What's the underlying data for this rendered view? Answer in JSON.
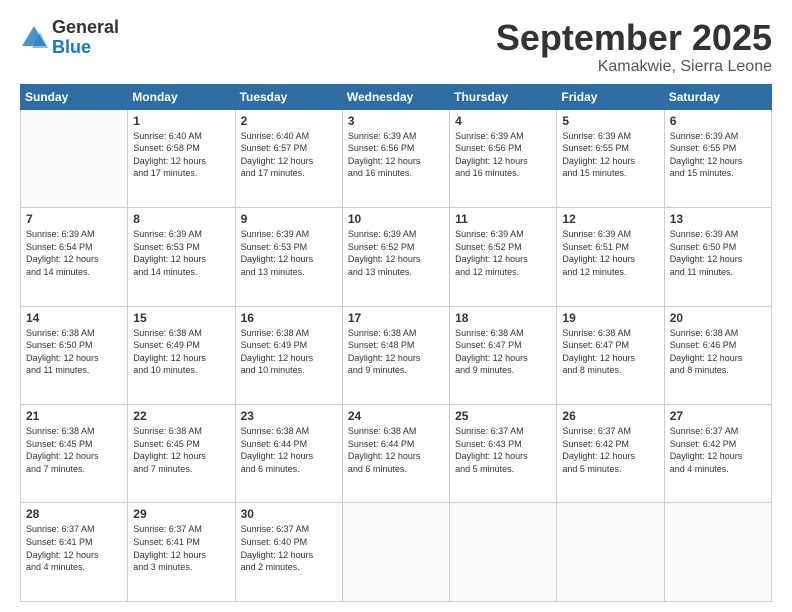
{
  "logo": {
    "general": "General",
    "blue": "Blue"
  },
  "header": {
    "month": "September 2025",
    "location": "Kamakwie, Sierra Leone"
  },
  "weekdays": [
    "Sunday",
    "Monday",
    "Tuesday",
    "Wednesday",
    "Thursday",
    "Friday",
    "Saturday"
  ],
  "weeks": [
    [
      {
        "day": "",
        "info": ""
      },
      {
        "day": "1",
        "info": "Sunrise: 6:40 AM\nSunset: 6:58 PM\nDaylight: 12 hours\nand 17 minutes."
      },
      {
        "day": "2",
        "info": "Sunrise: 6:40 AM\nSunset: 6:57 PM\nDaylight: 12 hours\nand 17 minutes."
      },
      {
        "day": "3",
        "info": "Sunrise: 6:39 AM\nSunset: 6:56 PM\nDaylight: 12 hours\nand 16 minutes."
      },
      {
        "day": "4",
        "info": "Sunrise: 6:39 AM\nSunset: 6:56 PM\nDaylight: 12 hours\nand 16 minutes."
      },
      {
        "day": "5",
        "info": "Sunrise: 6:39 AM\nSunset: 6:55 PM\nDaylight: 12 hours\nand 15 minutes."
      },
      {
        "day": "6",
        "info": "Sunrise: 6:39 AM\nSunset: 6:55 PM\nDaylight: 12 hours\nand 15 minutes."
      }
    ],
    [
      {
        "day": "7",
        "info": "Sunrise: 6:39 AM\nSunset: 6:54 PM\nDaylight: 12 hours\nand 14 minutes."
      },
      {
        "day": "8",
        "info": "Sunrise: 6:39 AM\nSunset: 6:53 PM\nDaylight: 12 hours\nand 14 minutes."
      },
      {
        "day": "9",
        "info": "Sunrise: 6:39 AM\nSunset: 6:53 PM\nDaylight: 12 hours\nand 13 minutes."
      },
      {
        "day": "10",
        "info": "Sunrise: 6:39 AM\nSunset: 6:52 PM\nDaylight: 12 hours\nand 13 minutes."
      },
      {
        "day": "11",
        "info": "Sunrise: 6:39 AM\nSunset: 6:52 PM\nDaylight: 12 hours\nand 12 minutes."
      },
      {
        "day": "12",
        "info": "Sunrise: 6:39 AM\nSunset: 6:51 PM\nDaylight: 12 hours\nand 12 minutes."
      },
      {
        "day": "13",
        "info": "Sunrise: 6:39 AM\nSunset: 6:50 PM\nDaylight: 12 hours\nand 11 minutes."
      }
    ],
    [
      {
        "day": "14",
        "info": "Sunrise: 6:38 AM\nSunset: 6:50 PM\nDaylight: 12 hours\nand 11 minutes."
      },
      {
        "day": "15",
        "info": "Sunrise: 6:38 AM\nSunset: 6:49 PM\nDaylight: 12 hours\nand 10 minutes."
      },
      {
        "day": "16",
        "info": "Sunrise: 6:38 AM\nSunset: 6:49 PM\nDaylight: 12 hours\nand 10 minutes."
      },
      {
        "day": "17",
        "info": "Sunrise: 6:38 AM\nSunset: 6:48 PM\nDaylight: 12 hours\nand 9 minutes."
      },
      {
        "day": "18",
        "info": "Sunrise: 6:38 AM\nSunset: 6:47 PM\nDaylight: 12 hours\nand 9 minutes."
      },
      {
        "day": "19",
        "info": "Sunrise: 6:38 AM\nSunset: 6:47 PM\nDaylight: 12 hours\nand 8 minutes."
      },
      {
        "day": "20",
        "info": "Sunrise: 6:38 AM\nSunset: 6:46 PM\nDaylight: 12 hours\nand 8 minutes."
      }
    ],
    [
      {
        "day": "21",
        "info": "Sunrise: 6:38 AM\nSunset: 6:45 PM\nDaylight: 12 hours\nand 7 minutes."
      },
      {
        "day": "22",
        "info": "Sunrise: 6:38 AM\nSunset: 6:45 PM\nDaylight: 12 hours\nand 7 minutes."
      },
      {
        "day": "23",
        "info": "Sunrise: 6:38 AM\nSunset: 6:44 PM\nDaylight: 12 hours\nand 6 minutes."
      },
      {
        "day": "24",
        "info": "Sunrise: 6:38 AM\nSunset: 6:44 PM\nDaylight: 12 hours\nand 6 minutes."
      },
      {
        "day": "25",
        "info": "Sunrise: 6:37 AM\nSunset: 6:43 PM\nDaylight: 12 hours\nand 5 minutes."
      },
      {
        "day": "26",
        "info": "Sunrise: 6:37 AM\nSunset: 6:42 PM\nDaylight: 12 hours\nand 5 minutes."
      },
      {
        "day": "27",
        "info": "Sunrise: 6:37 AM\nSunset: 6:42 PM\nDaylight: 12 hours\nand 4 minutes."
      }
    ],
    [
      {
        "day": "28",
        "info": "Sunrise: 6:37 AM\nSunset: 6:41 PM\nDaylight: 12 hours\nand 4 minutes."
      },
      {
        "day": "29",
        "info": "Sunrise: 6:37 AM\nSunset: 6:41 PM\nDaylight: 12 hours\nand 3 minutes."
      },
      {
        "day": "30",
        "info": "Sunrise: 6:37 AM\nSunset: 6:40 PM\nDaylight: 12 hours\nand 2 minutes."
      },
      {
        "day": "",
        "info": ""
      },
      {
        "day": "",
        "info": ""
      },
      {
        "day": "",
        "info": ""
      },
      {
        "day": "",
        "info": ""
      }
    ]
  ]
}
